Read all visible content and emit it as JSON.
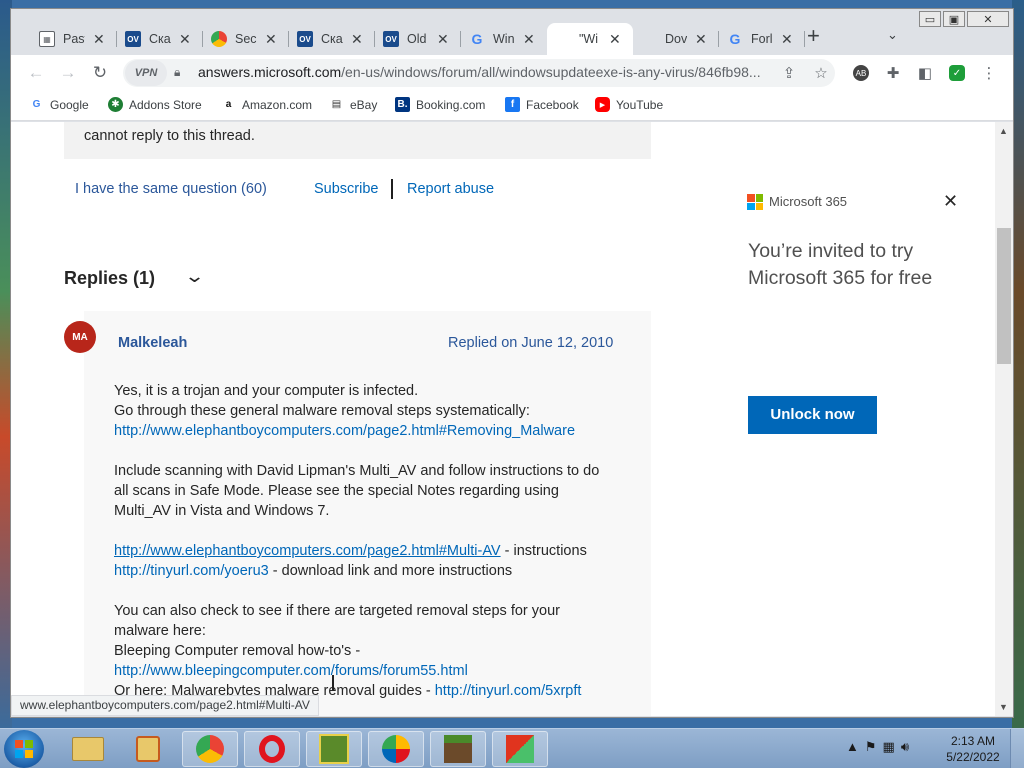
{
  "browser": {
    "tabs": [
      {
        "title": "Past",
        "icon": "calendar-icon",
        "color": "#5f6368"
      },
      {
        "title": "Ска",
        "icon": "ov-icon",
        "color": "#1a4b8c"
      },
      {
        "title": "Secu",
        "icon": "chrome-icon",
        "color": "#4285f4"
      },
      {
        "title": "Ска",
        "icon": "ov-icon",
        "color": "#1a4b8c"
      },
      {
        "title": "Old",
        "icon": "ov-icon",
        "color": "#1a4b8c"
      },
      {
        "title": "Win",
        "icon": "google-icon",
        "color": "#4285f4"
      },
      {
        "title": "\"Wi",
        "icon": "microsoft-icon",
        "color": "#f25022",
        "active": true
      },
      {
        "title": "Dov",
        "icon": "microsoft-icon",
        "color": "#f25022"
      },
      {
        "title": "Forl",
        "icon": "google-icon",
        "color": "#4285f4"
      }
    ],
    "new_tab": "+",
    "address": {
      "domain": "answers.microsoft.com",
      "path": "/en-us/windows/forum/all/windowsupdateexe-is-any-virus/846fb98...",
      "vpn_label": "VPN"
    },
    "bookmarks": [
      {
        "label": "Google",
        "icon": "google-icon",
        "glyph": "G",
        "color": "#4285f4"
      },
      {
        "label": "Addons Store",
        "icon": "addons-icon",
        "glyph": "✱",
        "color": "#1e7e34"
      },
      {
        "label": "Amazon.com",
        "icon": "amazon-icon",
        "glyph": "a",
        "color": "#111"
      },
      {
        "label": "eBay",
        "icon": "ebay-icon",
        "glyph": "▤",
        "color": "#333"
      },
      {
        "label": "Booking.com",
        "icon": "booking-icon",
        "glyph": "B.",
        "color": "#003580"
      },
      {
        "label": "Facebook",
        "icon": "facebook-icon",
        "glyph": "f",
        "color": "#1877f2"
      },
      {
        "label": "YouTube",
        "icon": "youtube-icon",
        "glyph": "▶",
        "color": "#ff0000"
      }
    ],
    "status_url": "www.elephantboycomputers.com/page2.html#Multi-AV"
  },
  "thread": {
    "notice_text": "cannot reply to this thread.",
    "same_question": "I have the same question (60)",
    "subscribe": "Subscribe",
    "report": "Report abuse",
    "replies_heading": "Replies (1)"
  },
  "reply": {
    "avatar": "MA",
    "author": "Malkeleah",
    "date": "Replied on June 12, 2010",
    "lines": {
      "l1": "Yes, it is a trojan and your computer is infected.",
      "l2": "Go through these general malware removal steps systematically:",
      "l3": "http://www.elephantboycomputers.com/page2.html#Removing_Malware",
      "l4": "Include scanning with David Lipman's Multi_AV and follow instructions to do",
      "l5": "all scans in Safe Mode. Please see the special Notes regarding using",
      "l6": "Multi_AV in Vista and Windows 7.",
      "l7_link": "http://www.elephantboycomputers.com/page2.html#Multi-AV",
      "l7_text": " - instructions",
      "l8_link": "http://tinyurl.com/yoeru3",
      "l8_text": " - download link and more instructions",
      "l9": "You can also check to see if there are targeted removal steps for your",
      "l10": "malware here:",
      "l11": "Bleeping Computer removal how-to's -",
      "l12": "http://www.bleepingcomputer.com/forums/forum55.html",
      "l13_text": "Or here: Malwarebytes malware removal guides - ",
      "l13_link": "http://tinyurl.com/5xrpft"
    }
  },
  "ad": {
    "brand": "Microsoft 365",
    "headline": "You’re invited to try Microsoft 365 for free",
    "button": "Unlock now"
  },
  "taskbar": {
    "time": "2:13 AM",
    "date": "5/22/2022",
    "apps": [
      "explorer-icon",
      "media-player-icon",
      "chrome-icon",
      "opera-icon",
      "game-icon",
      "vpn-icon",
      "minecraft-icon",
      "office-icon"
    ]
  },
  "colors": {
    "link": "#0067b8",
    "author": "#2b579a",
    "avatar": "#b8261a",
    "unlock": "#0067b8"
  }
}
